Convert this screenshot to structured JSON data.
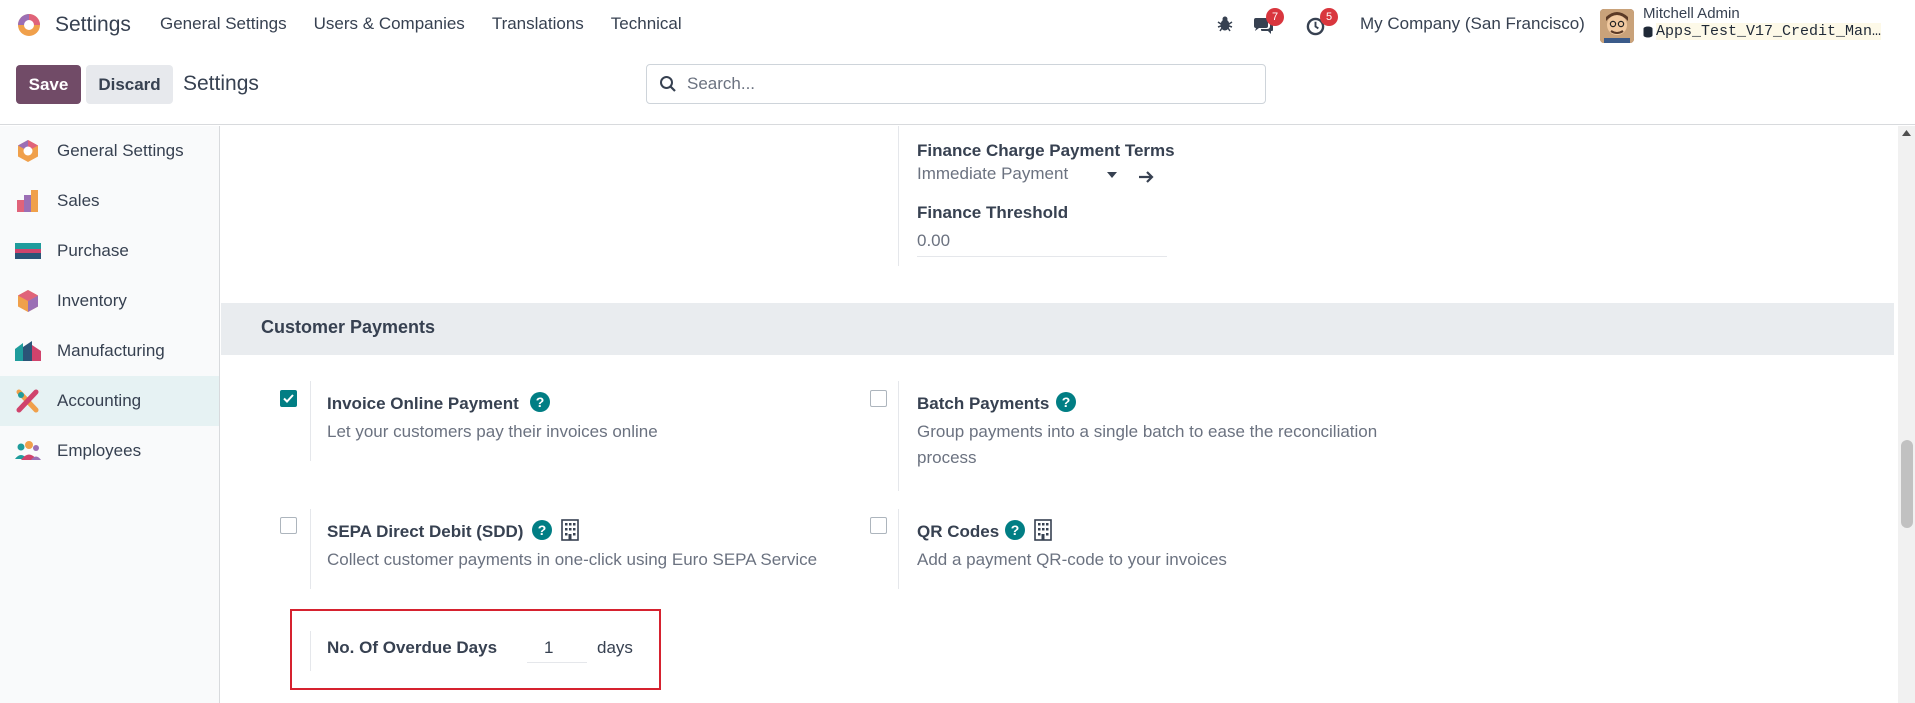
{
  "app": {
    "name": "Settings"
  },
  "topmenu": [
    "General Settings",
    "Users & Companies",
    "Translations",
    "Technical"
  ],
  "systray": {
    "messages_count": "7",
    "activities_count": "5",
    "company": "My Company (San Francisco)",
    "user": "Mitchell Admin",
    "database": "Apps_Test_V17_Credit_Man…"
  },
  "controls": {
    "save": "Save",
    "discard": "Discard",
    "title": "Settings",
    "search_placeholder": "Search..."
  },
  "sidebar": {
    "items": [
      "General Settings",
      "Sales",
      "Purchase",
      "Inventory",
      "Manufacturing",
      "Accounting",
      "Employees"
    ],
    "active": "Accounting"
  },
  "finance": {
    "terms_label": "Finance Charge Payment Terms",
    "terms_value": "Immediate Payment",
    "threshold_label": "Finance Threshold",
    "threshold_value": "0.00"
  },
  "section": {
    "title": "Customer Payments"
  },
  "settings": [
    {
      "title": "Invoice Online Payment",
      "desc": "Let your customers pay their invoices online",
      "checked": true
    },
    {
      "title": "Batch Payments",
      "desc1": "Group payments into a single batch to ease the reconciliation",
      "desc2": "process",
      "checked": false
    },
    {
      "title": "SEPA Direct Debit (SDD)",
      "desc": "Collect customer payments in one-click using Euro SEPA Service",
      "checked": false
    },
    {
      "title": "QR Codes",
      "desc": "Add a payment QR-code to your invoices",
      "checked": false
    }
  ],
  "overdue": {
    "label": "No. Of Overdue Days",
    "value": "1",
    "unit": "days"
  },
  "colors": {
    "brand": "#714b67",
    "accent": "#017e84",
    "highlight": "#d6222f"
  }
}
